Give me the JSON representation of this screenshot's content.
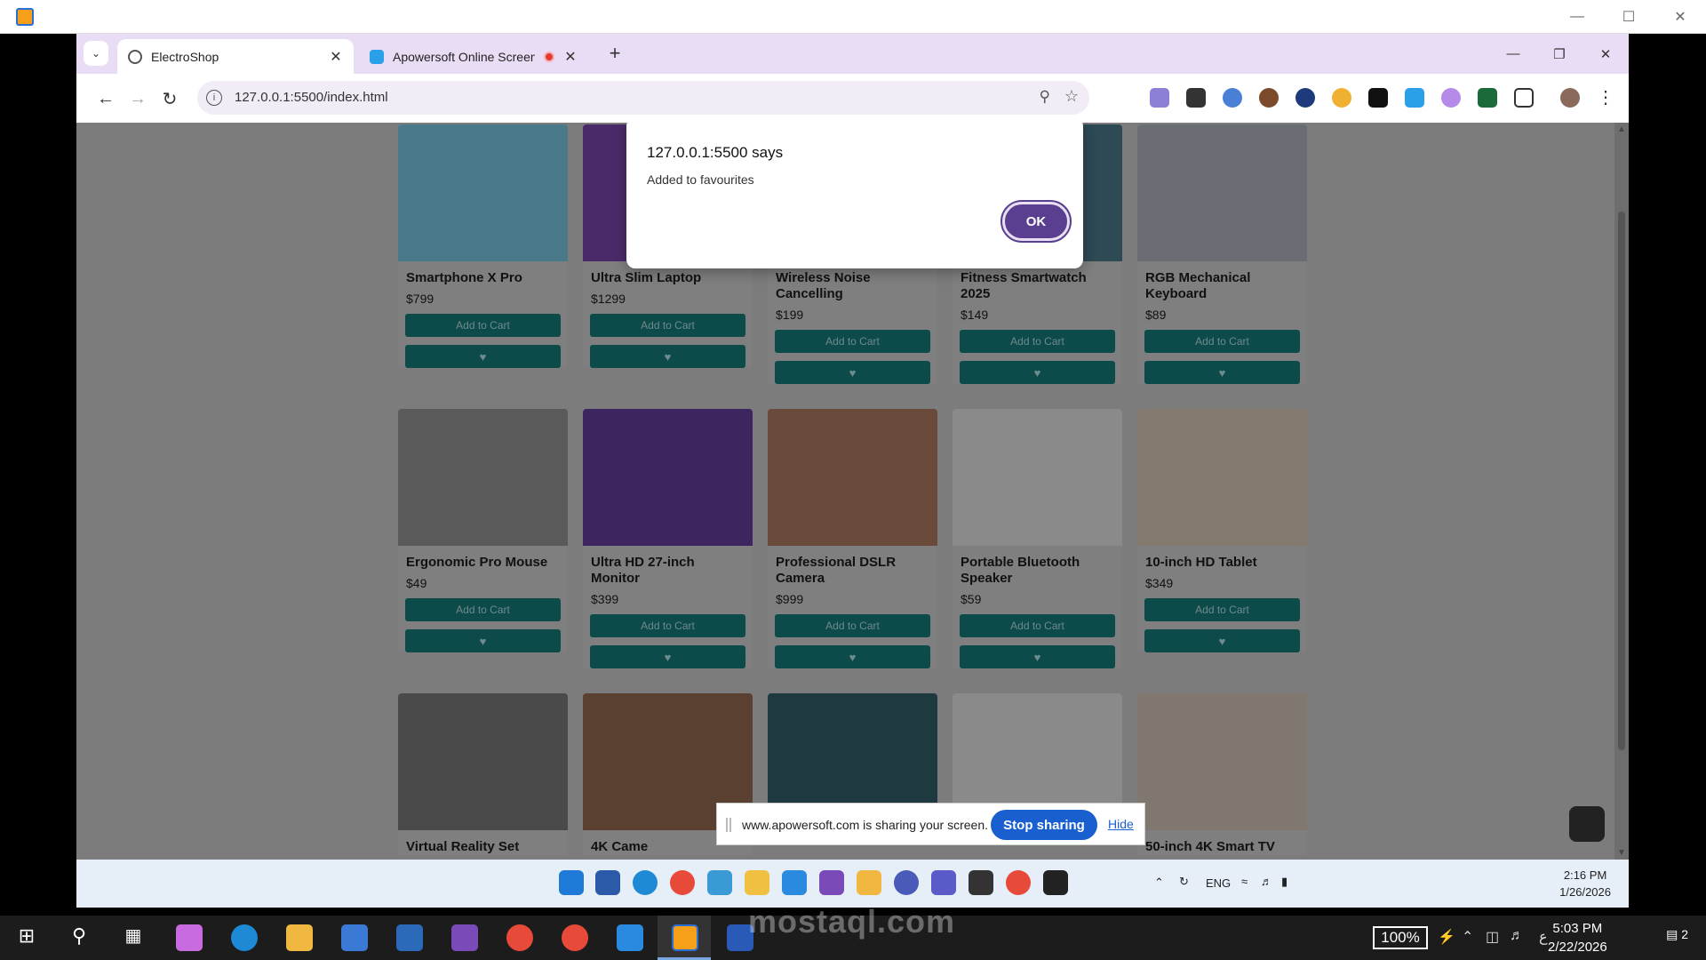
{
  "browser": {
    "tabs": [
      {
        "title": "ElectroShop"
      },
      {
        "title": "Apowersoft Online Screen R"
      }
    ],
    "url": "127.0.0.1:5500/index.html"
  },
  "alert": {
    "title": "127.0.0.1:5500 says",
    "message": "Added to favourites",
    "ok_label": "OK"
  },
  "shop": {
    "add_to_cart_label": "Add to Cart",
    "products": [
      {
        "name": "Smartphone X Pro",
        "price": "$799",
        "color": "#4a7a8a"
      },
      {
        "name": "Ultra Slim Laptop",
        "price": "$1299",
        "color": "#4b2a6a"
      },
      {
        "name": "Wireless Noise Cancelling",
        "price": "$199",
        "color": "#4a5a66"
      },
      {
        "name": "Fitness Smartwatch 2025",
        "price": "$149",
        "color": "#2d4a55"
      },
      {
        "name": "RGB Mechanical Keyboard",
        "price": "$89",
        "color": "#6a6e74"
      },
      {
        "name": "Ergonomic Pro Mouse",
        "price": "$49",
        "color": "#5a5a5a"
      },
      {
        "name": "Ultra HD 27-inch Monitor",
        "price": "$399",
        "color": "#3d2560"
      },
      {
        "name": "Professional DSLR Camera",
        "price": "$999",
        "color": "#6a4a3a"
      },
      {
        "name": "Portable Bluetooth Speaker",
        "price": "$59",
        "color": "#8a8a8a"
      },
      {
        "name": "10-inch HD Tablet",
        "price": "$349",
        "color": "#857a70"
      },
      {
        "name": "Virtual Reality Set",
        "price": "",
        "color": "#4a4a4a"
      },
      {
        "name": "4K Came",
        "price": "",
        "color": "#5a4030"
      },
      {
        "name": "",
        "price": "",
        "color": "#1e3a40"
      },
      {
        "name": "",
        "price": "",
        "color": "#8a8a8a"
      },
      {
        "name": "50-inch 4K Smart TV",
        "price": "",
        "color": "#80786e"
      }
    ]
  },
  "share_bar": {
    "text": "www.apowersoft.com is sharing your screen.",
    "stop_label": "Stop sharing",
    "hide_label": "Hide"
  },
  "inner_taskbar": {
    "lang": "ENG",
    "time": "2:16 PM",
    "date": "1/26/2026"
  },
  "taskbar": {
    "battery": "100%",
    "lang": "ع",
    "time": "5:03 PM",
    "date": "2/22/2026",
    "notifications": "2"
  },
  "watermark": "mostaql.com"
}
